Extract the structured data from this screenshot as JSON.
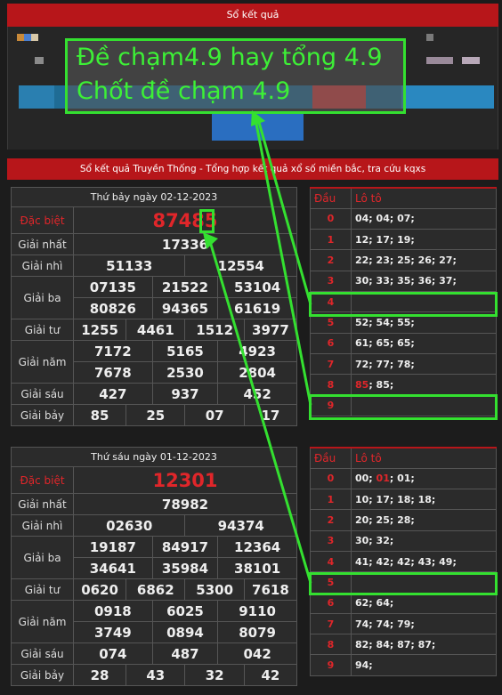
{
  "header": {
    "title": "Sổ kết quả"
  },
  "overlay": {
    "line1": "Đề chạm4.9 hay tổng 4.9",
    "line2": "Chốt đề chạm 4.9"
  },
  "section": {
    "title": "Sổ kết quả Truyền Thống - Tổng hợp kết quả xổ số miền bắc, tra cứu kqxs"
  },
  "colors": {
    "accent": "#b7161a",
    "highlight": "#34e030",
    "banner": "#1f6c95"
  },
  "results": [
    {
      "date": "Thứ bảy ngày 02-12-2023",
      "labels": [
        "Đặc biệt",
        "Giải nhất",
        "Giải nhì",
        "Giải ba",
        "Giải tư",
        "Giải năm",
        "Giải sáu",
        "Giải bảy"
      ],
      "special": "87485",
      "special_main": "8748",
      "special_last": "5",
      "first": "17336",
      "second": [
        "51133",
        "12554"
      ],
      "third": [
        "07135",
        "21522",
        "53104",
        "80826",
        "94365",
        "61619"
      ],
      "fourth": [
        "1255",
        "4461",
        "1512",
        "3977"
      ],
      "fifth": [
        "7172",
        "5165",
        "4923",
        "7678",
        "2530",
        "2804"
      ],
      "sixth": [
        "427",
        "937",
        "452"
      ],
      "seventh": [
        "85",
        "25",
        "07",
        "17"
      ],
      "loto_header": [
        "Đầu",
        "Lô tô"
      ],
      "loto": [
        {
          "dau": "0",
          "values": "04; 04; 07;"
        },
        {
          "dau": "1",
          "values": "12; 17; 19;"
        },
        {
          "dau": "2",
          "values": "22; 23; 25; 26; 27;"
        },
        {
          "dau": "3",
          "values": "30; 33; 35; 36; 37;"
        },
        {
          "dau": "4",
          "values": ""
        },
        {
          "dau": "5",
          "values": "52; 54; 55;"
        },
        {
          "dau": "6",
          "values": "61; 65; 65;"
        },
        {
          "dau": "7",
          "values": "72; 77; 78;"
        },
        {
          "dau": "8",
          "values_red": "85",
          "values": "; 85;"
        },
        {
          "dau": "9",
          "values": ""
        }
      ]
    },
    {
      "date": "Thứ sáu ngày 01-12-2023",
      "labels": [
        "Đặc biệt",
        "Giải nhất",
        "Giải nhì",
        "Giải ba",
        "Giải tư",
        "Giải năm",
        "Giải sáu",
        "Giải bảy"
      ],
      "special": "12301",
      "first": "78982",
      "second": [
        "02630",
        "94374"
      ],
      "third": [
        "19187",
        "84917",
        "12364",
        "34641",
        "35984",
        "38101"
      ],
      "fourth": [
        "0620",
        "6862",
        "5300",
        "7618"
      ],
      "fifth": [
        "0918",
        "6025",
        "9110",
        "3749",
        "0894",
        "8079"
      ],
      "sixth": [
        "074",
        "487",
        "042"
      ],
      "seventh": [
        "28",
        "43",
        "32",
        "42"
      ],
      "loto_header": [
        "Đầu",
        "Lô tô"
      ],
      "loto": [
        {
          "dau": "0",
          "values_a": "00; ",
          "values_red": "01",
          "values": "; 01;"
        },
        {
          "dau": "1",
          "values": "10; 17; 18; 18;"
        },
        {
          "dau": "2",
          "values": "20; 25; 28;"
        },
        {
          "dau": "3",
          "values": "30; 32;"
        },
        {
          "dau": "4",
          "values": "41; 42; 42; 43; 49;"
        },
        {
          "dau": "5",
          "values": ""
        },
        {
          "dau": "6",
          "values": "62; 64;"
        },
        {
          "dau": "7",
          "values": "74; 74; 79;"
        },
        {
          "dau": "8",
          "values": "82; 84; 87; 87;"
        },
        {
          "dau": "9",
          "values": "94;"
        }
      ]
    }
  ]
}
